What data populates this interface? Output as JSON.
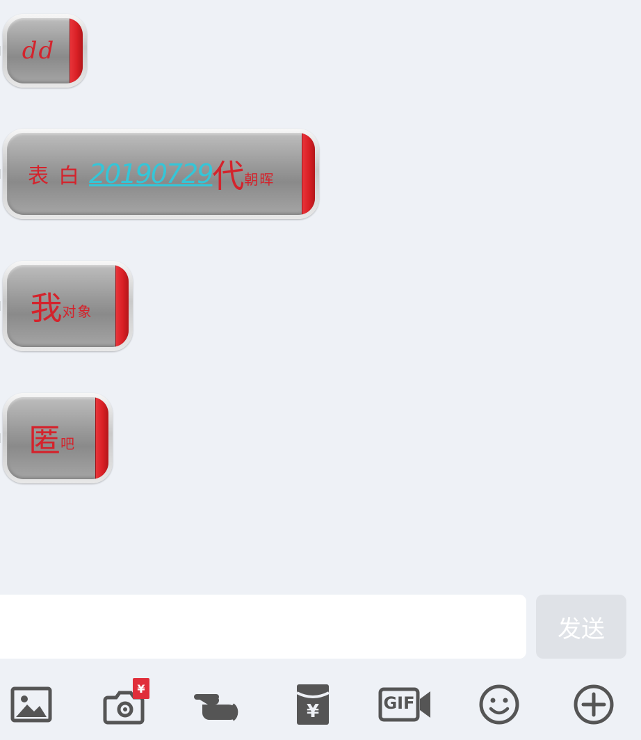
{
  "messages": [
    {
      "parts": [
        {
          "text": "dd",
          "style": "small-latin"
        }
      ]
    },
    {
      "parts": [
        {
          "text": "表白",
          "style": "medium"
        },
        {
          "text": "20190729",
          "style": "link"
        },
        {
          "text": "代",
          "style": "big"
        },
        {
          "text": "朝晖",
          "style": "small"
        }
      ]
    },
    {
      "parts": [
        {
          "text": "我",
          "style": "big"
        },
        {
          "text": "对象",
          "style": "small"
        }
      ]
    },
    {
      "parts": [
        {
          "text": "匿",
          "style": "big"
        },
        {
          "text": "吧",
          "style": "small"
        }
      ]
    }
  ],
  "input": {
    "value": "",
    "placeholder": ""
  },
  "send_button": {
    "label": "发送"
  },
  "toolbar": [
    {
      "icon": "image-icon"
    },
    {
      "icon": "camera-icon",
      "badge": "¥"
    },
    {
      "icon": "poke-hand-icon"
    },
    {
      "icon": "red-packet-icon",
      "glyph": "¥"
    },
    {
      "icon": "gif-icon",
      "label": "GIF"
    },
    {
      "icon": "emoji-icon"
    },
    {
      "icon": "plus-icon"
    }
  ],
  "colors": {
    "background": "#eef1f6",
    "bubble_text": "#d4232c",
    "link_text": "#34c6d8",
    "bubble_bar": "#d81f24",
    "icon": "#555555",
    "badge": "#e02e3a"
  }
}
